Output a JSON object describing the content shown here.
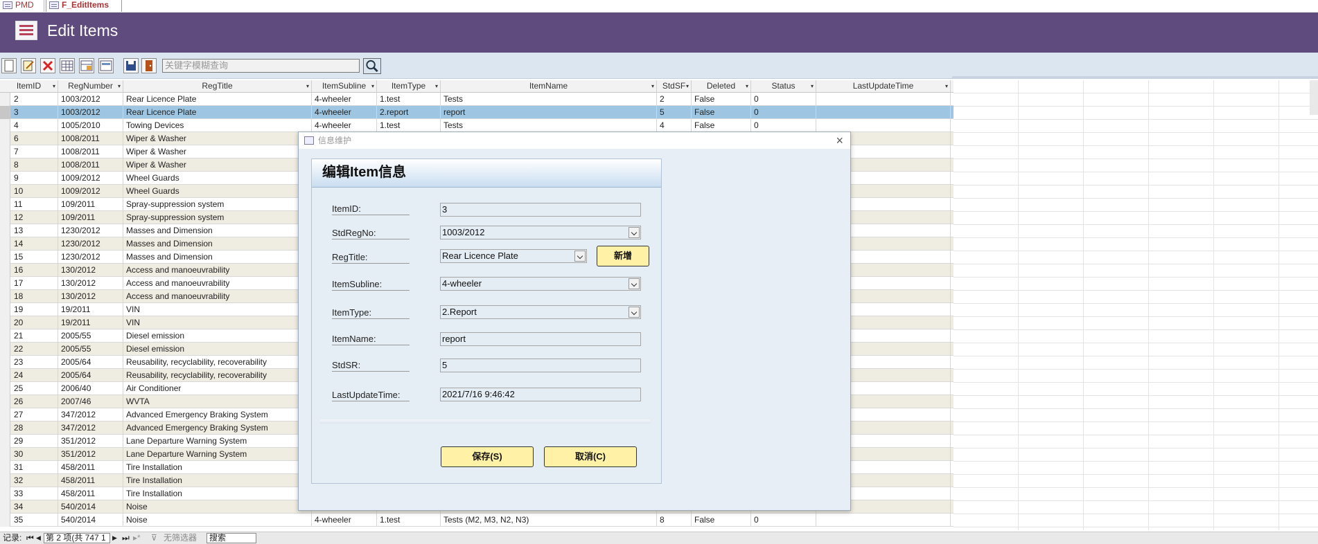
{
  "tabs": [
    {
      "label": "PMD"
    },
    {
      "label": "F_EditItems"
    }
  ],
  "header": {
    "title": "Edit Items"
  },
  "toolbar": {
    "search_placeholder": "关键字模糊查询"
  },
  "grid": {
    "columns": [
      {
        "label": "ItemID",
        "w": 84
      },
      {
        "label": "RegNumber",
        "w": 94
      },
      {
        "label": "RegTitle",
        "w": 272
      },
      {
        "label": "ItemSubline",
        "w": 94
      },
      {
        "label": "ItemType",
        "w": 92
      },
      {
        "label": "ItemName",
        "w": 312
      },
      {
        "label": "StdSF",
        "w": 50
      },
      {
        "label": "Deleted",
        "w": 86
      },
      {
        "label": "Status",
        "w": 94
      },
      {
        "label": "LastUpdateTime",
        "w": 194
      }
    ],
    "rows": [
      [
        "2",
        "1003/2012",
        "Rear Licence Plate",
        "4-wheeler",
        "1.test",
        "Tests",
        "2",
        "False",
        "0",
        ""
      ],
      [
        "3",
        "1003/2012",
        "Rear Licence Plate",
        "4-wheeler",
        "2.report",
        "report",
        "5",
        "False",
        "0",
        ""
      ],
      [
        "4",
        "1005/2010",
        "Towing Devices",
        "4-wheeler",
        "1.test",
        "Tests",
        "4",
        "False",
        "0",
        ""
      ],
      [
        "6",
        "1008/2011",
        "Wiper & Washer",
        "",
        "",
        "",
        "",
        "",
        "",
        ""
      ],
      [
        "7",
        "1008/2011",
        "Wiper & Washer",
        "",
        "",
        "",
        "",
        "",
        "",
        ""
      ],
      [
        "8",
        "1008/2011",
        "Wiper & Washer",
        "",
        "",
        "",
        "",
        "",
        "",
        ""
      ],
      [
        "9",
        "1009/2012",
        "Wheel Guards",
        "",
        "",
        "",
        "",
        "",
        "",
        ""
      ],
      [
        "10",
        "1009/2012",
        "Wheel Guards",
        "",
        "",
        "",
        "",
        "",
        "",
        ""
      ],
      [
        "11",
        "109/2011",
        "Spray-suppression system",
        "",
        "",
        "",
        "",
        "",
        "",
        ""
      ],
      [
        "12",
        "109/2011",
        "Spray-suppression system",
        "",
        "",
        "",
        "",
        "",
        "",
        ""
      ],
      [
        "13",
        "1230/2012",
        "Masses and Dimension",
        "",
        "",
        "",
        "",
        "",
        "",
        ""
      ],
      [
        "14",
        "1230/2012",
        "Masses and Dimension",
        "",
        "",
        "",
        "",
        "",
        "",
        ""
      ],
      [
        "15",
        "1230/2012",
        "Masses and Dimension",
        "",
        "",
        "",
        "",
        "",
        "",
        ""
      ],
      [
        "16",
        "130/2012",
        "Access and manoeuvrability",
        "",
        "",
        "",
        "",
        "",
        "",
        ""
      ],
      [
        "17",
        "130/2012",
        "Access and manoeuvrability",
        "",
        "",
        "",
        "",
        "",
        "",
        ""
      ],
      [
        "18",
        "130/2012",
        "Access and manoeuvrability",
        "",
        "",
        "",
        "",
        "",
        "",
        ""
      ],
      [
        "19",
        "19/2011",
        "VIN",
        "",
        "",
        "",
        "",
        "",
        "",
        ""
      ],
      [
        "20",
        "19/2011",
        "VIN",
        "",
        "",
        "",
        "",
        "",
        "",
        ""
      ],
      [
        "21",
        "2005/55",
        "Diesel emission",
        "",
        "",
        "",
        "",
        "",
        "",
        ""
      ],
      [
        "22",
        "2005/55",
        "Diesel emission",
        "",
        "",
        "",
        "",
        "",
        "",
        ""
      ],
      [
        "23",
        "2005/64",
        "Reusability, recyclability, recoverability",
        "",
        "",
        "",
        "",
        "",
        "",
        ""
      ],
      [
        "24",
        "2005/64",
        "Reusability, recyclability, recoverability",
        "",
        "",
        "",
        "",
        "",
        "",
        ""
      ],
      [
        "25",
        "2006/40",
        "Air Conditioner",
        "",
        "",
        "",
        "",
        "",
        "",
        ""
      ],
      [
        "26",
        "2007/46",
        "WVTA",
        "",
        "",
        "",
        "",
        "",
        "",
        ""
      ],
      [
        "27",
        "347/2012",
        "Advanced Emergency Braking System",
        "",
        "",
        "",
        "",
        "",
        "",
        ""
      ],
      [
        "28",
        "347/2012",
        "Advanced Emergency Braking System",
        "",
        "",
        "",
        "",
        "",
        "",
        ""
      ],
      [
        "29",
        "351/2012",
        "Lane Departure Warning System",
        "",
        "",
        "",
        "",
        "",
        "",
        ""
      ],
      [
        "30",
        "351/2012",
        "Lane Departure Warning System",
        "",
        "",
        "",
        "",
        "",
        "",
        ""
      ],
      [
        "31",
        "458/2011",
        "Tire Installation",
        "",
        "",
        "",
        "",
        "",
        "",
        ""
      ],
      [
        "32",
        "458/2011",
        "Tire Installation",
        "",
        "",
        "",
        "",
        "",
        "",
        ""
      ],
      [
        "33",
        "458/2011",
        "Tire Installation",
        "",
        "",
        "",
        "",
        "",
        "",
        ""
      ],
      [
        "34",
        "540/2014",
        "Noise",
        "",
        "",
        "",
        "",
        "",
        "",
        ""
      ],
      [
        "35",
        "540/2014",
        "Noise",
        "4-wheeler",
        "1.test",
        "Tests (M2, M3, N2, N3)",
        "8",
        "False",
        "0",
        ""
      ]
    ],
    "selected_index": 1
  },
  "statusbar": {
    "record_label": "记录:",
    "record_nav": "第 2 项(共 747 1",
    "filter": "无筛选器",
    "search": "搜索"
  },
  "dialog": {
    "title": "信息维护",
    "panel_title": "编辑Item信息",
    "fields": {
      "itemid_label": "ItemID:",
      "itemid_value": "3",
      "stdregno_label": "StdRegNo:",
      "stdregno_value": "1003/2012",
      "regtitle_label": "RegTitle:",
      "regtitle_value": "Rear Licence Plate",
      "itemsubline_label": "ItemSubline:",
      "itemsubline_value": "4-wheeler",
      "itemtype_label": "ItemType:",
      "itemtype_value": "2.Report",
      "itemname_label": "ItemName:",
      "itemname_value": "report",
      "stdsr_label": "StdSR:",
      "stdsr_value": "5",
      "lastupdate_label": "LastUpdateTime:",
      "lastupdate_value": "2021/7/16 9:46:42"
    },
    "add_label": "新增",
    "save_label": "保存(S)",
    "cancel_label": "取消(C)"
  }
}
